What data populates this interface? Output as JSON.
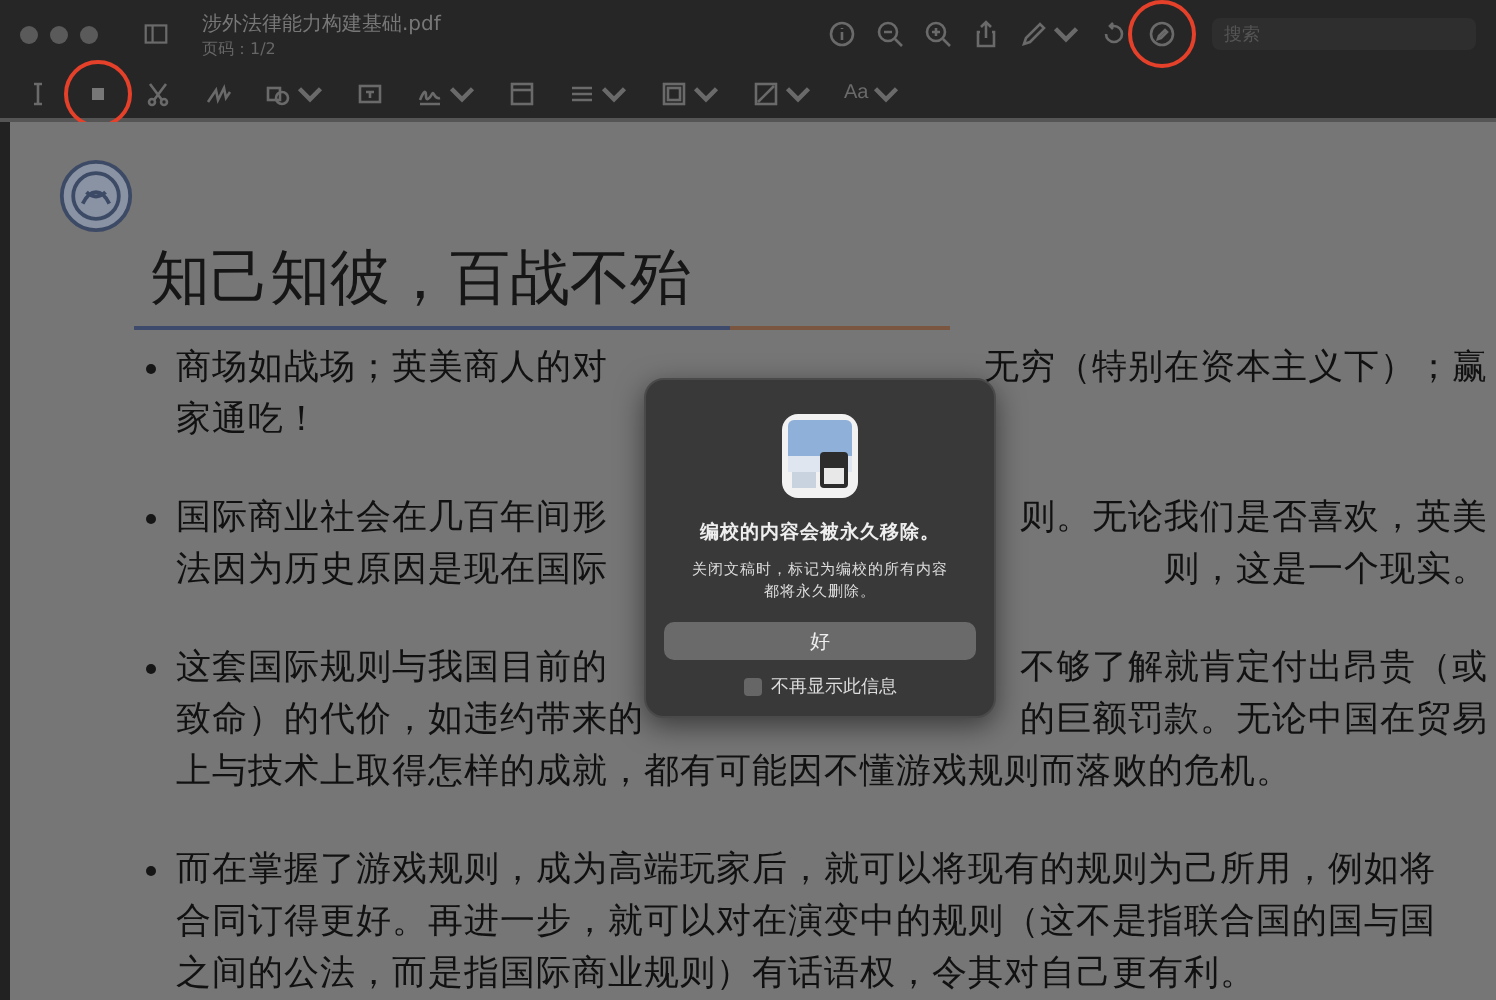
{
  "window": {
    "title": "涉外法律能力构建基础.pdf",
    "subtitle": "页码：1/2"
  },
  "toolbar": [
    {
      "kind": "info",
      "circled": false
    },
    {
      "kind": "zoom-out",
      "circled": false
    },
    {
      "kind": "zoom-in",
      "circled": false
    },
    {
      "kind": "share",
      "circled": false
    },
    {
      "kind": "markup",
      "circled": false
    },
    {
      "kind": "rotate",
      "circled": false
    },
    {
      "kind": "annotate",
      "circled": true
    }
  ],
  "search": {
    "placeholder": "搜索"
  },
  "markup_bar": [
    {
      "kind": "text-select",
      "circled": false
    },
    {
      "kind": "rect-select",
      "circled": true
    },
    {
      "kind": "scissors",
      "circled": false
    },
    {
      "kind": "sketch",
      "circled": false
    },
    {
      "kind": "shapes",
      "circled": false
    },
    {
      "kind": "textbox",
      "circled": false
    },
    {
      "kind": "signature",
      "circled": false
    },
    {
      "kind": "note",
      "circled": false
    },
    {
      "kind": "line-style",
      "circled": false
    },
    {
      "kind": "border-color",
      "circled": false
    },
    {
      "kind": "fill-color",
      "circled": false
    },
    {
      "kind": "font",
      "label": "Aa",
      "circled": false
    }
  ],
  "document": {
    "heading": "知己知彼，百战不殆",
    "bullets": [
      {
        "lines": [
          {
            "left": "商场如战场；英美商人的对",
            "right": "无穷（特别在资本主义下）；赢"
          },
          {
            "left": "家通吃！"
          }
        ]
      },
      {
        "lines": [
          {
            "left": "国际商业社会在几百年间形",
            "right": "则。无论我们是否喜欢，英美"
          },
          {
            "left": "法因为历史原因是现在国际",
            "right": "则，这是一个现实。"
          }
        ]
      },
      {
        "lines": [
          {
            "left": "这套国际规则与我国目前的",
            "right": "不够了解就肯定付出昂贵（或"
          },
          {
            "left": "致命）的代价，如违约带来的",
            "right": "的巨额罚款。无论中国在贸易"
          },
          {
            "left": "上与技术上取得怎样的成就，都有可能因不懂游戏规则而落败的危机。"
          }
        ]
      },
      {
        "lines": [
          {
            "left": "而在掌握了游戏规则，成为高端玩家后，就可以将现有的规则为己所用，例如将"
          },
          {
            "left": "合同订得更好。再进一步，就可以对在演变中的规则（这不是指联合国的国与国"
          },
          {
            "left": "之间的公法，而是指国际商业规则）有话语权，令其对自己更有利。"
          }
        ]
      }
    ]
  },
  "dialog": {
    "title": "编校的内容会被永久移除。",
    "message": "关闭文稿时，标记为编校的所有内容都将永久删除。",
    "button": "好",
    "checkbox": {
      "label": "不再显示此信息",
      "checked": false
    }
  }
}
